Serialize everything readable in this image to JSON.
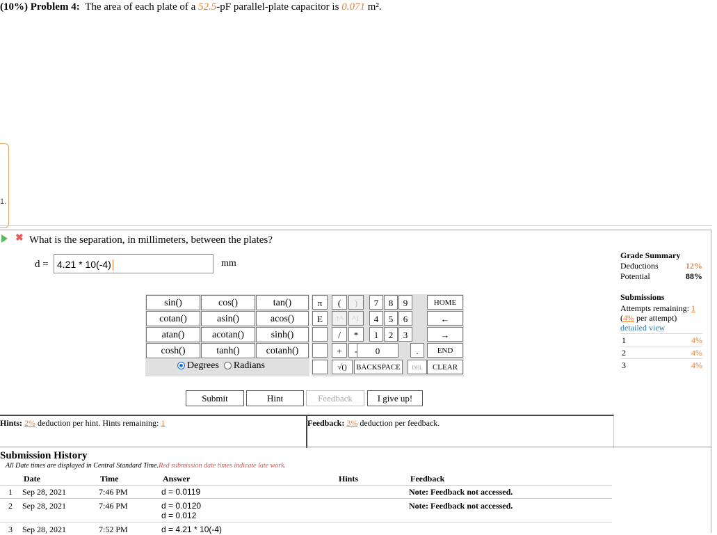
{
  "problem": {
    "prefix": "(10%) Problem 4:",
    "text_a": "The area of each plate of a ",
    "capacitance": "52.5",
    "text_b": "-pF parallel-plate capacitor is ",
    "area": "0.071",
    "text_c": " m².",
    "left_number": "1."
  },
  "question": {
    "text": "What is the separation, in millimeters, between the plates?",
    "label": "d =",
    "input_value": "4.21 * 10(-4)",
    "unit": "mm"
  },
  "calculator": {
    "functions": [
      "sin()",
      "cos()",
      "tan()",
      "cotan()",
      "asin()",
      "acos()",
      "atan()",
      "acotan()",
      "sinh()",
      "cosh()",
      "tanh()",
      "cotanh()"
    ],
    "degrees": "Degrees",
    "radians": "Radians",
    "keys": {
      "pi": "π",
      "lparen": "(",
      "rparen": ")",
      "e": "E",
      "up1": "↑^",
      "up2": "^↓",
      "slash": "/",
      "star": "*",
      "plus": "+",
      "minus": "-",
      "sqrt": "√()",
      "n7": "7",
      "n8": "8",
      "n9": "9",
      "n4": "4",
      "n5": "5",
      "n6": "6",
      "n1": "1",
      "n2": "2",
      "n3": "3",
      "n0": "0",
      "dot": ".",
      "home": "HOME",
      "left": "←",
      "right": "→",
      "end": "END",
      "backspace": "BACKSPACE",
      "del": "DEL",
      "clear": "CLEAR"
    }
  },
  "actions": {
    "submit": "Submit",
    "hint": "Hint",
    "feedback": "Feedback",
    "give_up": "I give up!"
  },
  "hints": {
    "label": "Hints:",
    "pct": "2%",
    "text": " deduction per hint. Hints remaining: ",
    "remaining": "1"
  },
  "feedback": {
    "label": "Feedback:",
    "pct": "3%",
    "text": " deduction per feedback."
  },
  "grade": {
    "title": "Grade Summary",
    "deductions_label": "Deductions",
    "deductions": "12%",
    "potential_label": "Potential",
    "potential": "88%",
    "submissions_title": "Submissions",
    "attempts_label": "Attempts remaining: ",
    "attempts": "1",
    "per_attempt_pct": "4%",
    "per_attempt_text": " per attempt)",
    "detailed": "detailed view",
    "rows": [
      {
        "n": "1",
        "pct": "4%"
      },
      {
        "n": "2",
        "pct": "4%"
      },
      {
        "n": "3",
        "pct": "4%"
      }
    ]
  },
  "history": {
    "title": "Submission History",
    "note_a": "All Date times are displayed in Central Standard Time.",
    "note_b": "Red submission date times indicate late work.",
    "headers": {
      "date": "Date",
      "time": "Time",
      "answer": "Answer",
      "hints": "Hints",
      "feedback": "Feedback"
    },
    "rows": [
      {
        "n": "1",
        "date": "Sep 28, 2021",
        "time": "7:46 PM",
        "answer": "d = 0.0119",
        "answer2": "",
        "feedback": "Note: Feedback not accessed."
      },
      {
        "n": "2",
        "date": "Sep 28, 2021",
        "time": "7:46 PM",
        "answer": "d = 0.0120",
        "answer2": "d = 0.012",
        "feedback": "Note: Feedback not accessed."
      },
      {
        "n": "3",
        "date": "Sep 28, 2021",
        "time": "7:52 PM",
        "answer": "d = 4.21 * 10(-4)",
        "answer2": "",
        "feedback": ""
      }
    ]
  }
}
